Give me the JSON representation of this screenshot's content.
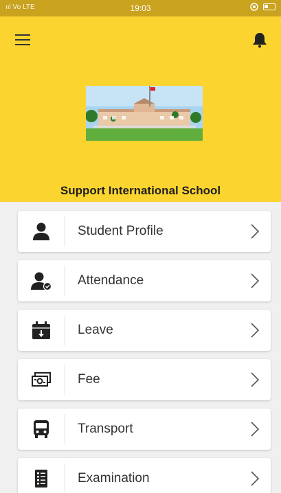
{
  "status_bar": {
    "time": "19:03",
    "signal_text": "ııl Vo LTE"
  },
  "header": {
    "school_name": "Support International School",
    "background_color": "#fcd430"
  },
  "menu": {
    "items": [
      {
        "label": "Student Profile",
        "icon": "student-icon"
      },
      {
        "label": "Attendance",
        "icon": "attendance-icon"
      },
      {
        "label": "Leave",
        "icon": "calendar-icon"
      },
      {
        "label": "Fee",
        "icon": "money-icon"
      },
      {
        "label": "Transport",
        "icon": "bus-icon"
      },
      {
        "label": "Examination",
        "icon": "exam-icon"
      }
    ]
  }
}
